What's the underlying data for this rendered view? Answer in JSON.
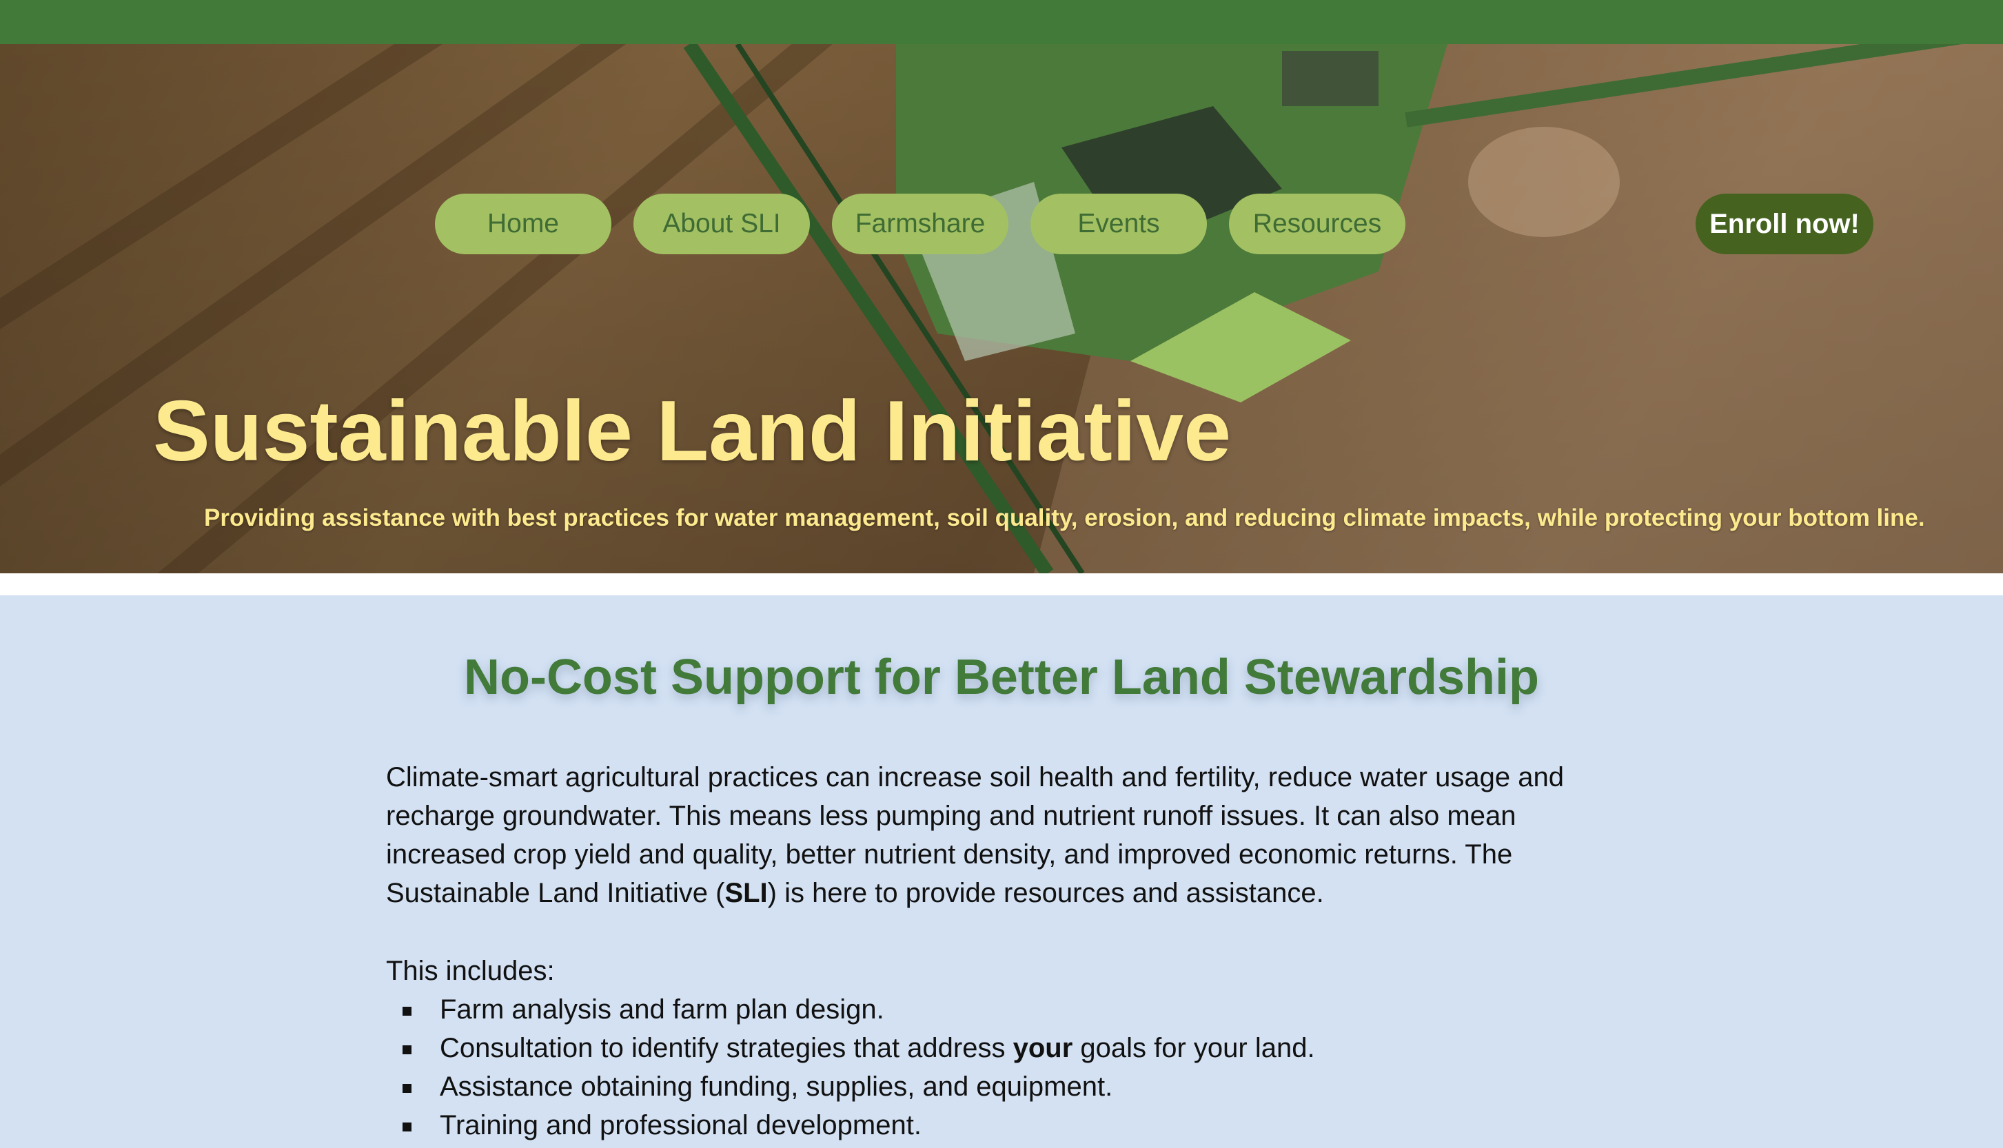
{
  "colors": {
    "top_bar": "#427a3a",
    "nav_pill": "#a3c163",
    "nav_text": "#3f6b34",
    "enroll_bg": "#45631f",
    "hero_text": "#fdea8f",
    "content_bg": "#d3e1f3",
    "heading": "#427a3a"
  },
  "nav": {
    "items": [
      {
        "label": "Home"
      },
      {
        "label": "About SLI"
      },
      {
        "label": "Farmshare"
      },
      {
        "label": "Events"
      },
      {
        "label": "Resources"
      }
    ],
    "enroll_label": "Enroll now!"
  },
  "hero": {
    "title": "Sustainable Land Initiative",
    "subtitle": "Providing assistance with best practices for water management, soil quality, erosion, and reducing climate impacts, while protecting your bottom line.",
    "background_image": "aerial-combine-harvester-in-field"
  },
  "main": {
    "heading": "No-Cost Support for Better Land Stewardship",
    "intro_part1": "Climate-smart agricultural practices can increase soil health and fertility, reduce water usage and recharge groundwater. This means less pumping and nutrient runoff issues. It can also mean increased crop yield and quality, better nutrient density, and improved economic returns. The Sustainable Land Initiative (",
    "intro_bold": "SLI",
    "intro_part2": ") is here to provide resources and assistance.",
    "includes_label": "This includes:",
    "list": [
      {
        "before": "Farm analysis and farm plan design.",
        "bold": "",
        "after": ""
      },
      {
        "before": "Consultation to identify strategies that address ",
        "bold": "your",
        "after": " goals for your land."
      },
      {
        "before": "Assistance obtaining funding, supplies, and equipment.",
        "bold": "",
        "after": ""
      },
      {
        "before": "Training and professional development.",
        "bold": "",
        "after": ""
      }
    ]
  }
}
